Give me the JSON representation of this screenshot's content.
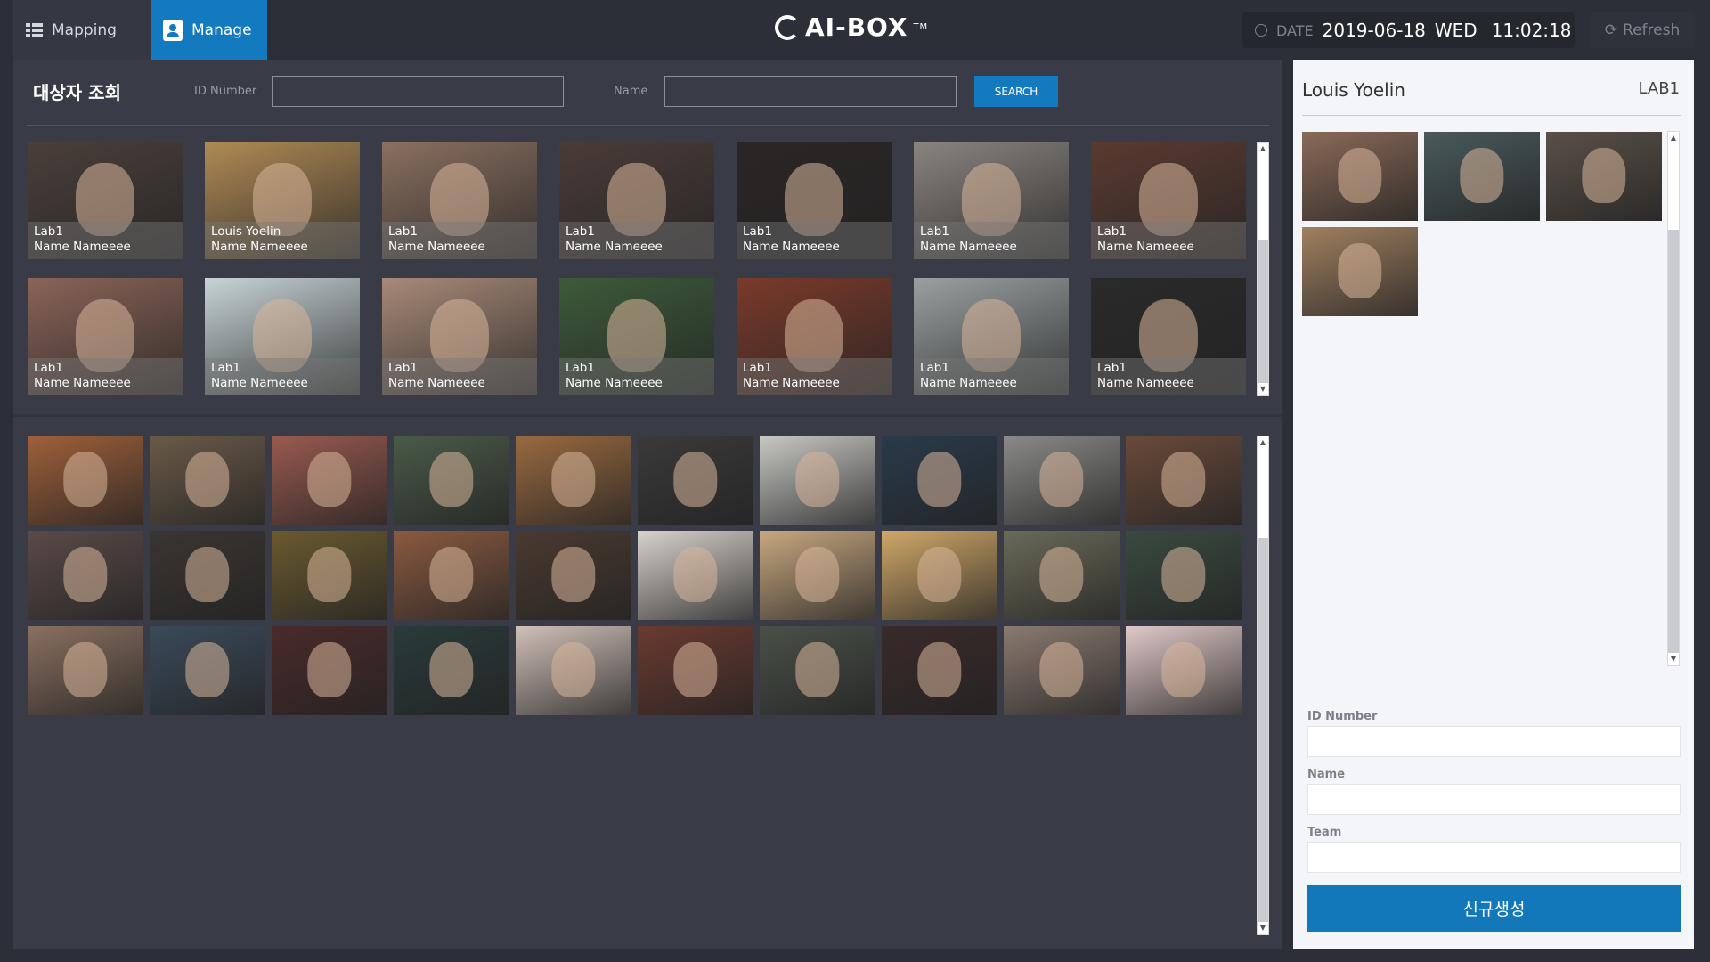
{
  "header": {
    "tabs": [
      {
        "label": "Mapping",
        "icon": "list-icon"
      },
      {
        "label": "Manage",
        "icon": "user-badge-icon",
        "active": true
      }
    ],
    "logo": "AI-BOX",
    "logo_tm": "TM",
    "date_label": "DATE",
    "date": "2019-06-18",
    "weekday": "WED",
    "time": "11:02:18",
    "refresh_label": "Refresh"
  },
  "search": {
    "title": "대상자 조회",
    "id_label": "ID Number",
    "id_value": "",
    "name_label": "Name",
    "name_value": "",
    "button": "SEARCH"
  },
  "cards": [
    {
      "team": "Lab1",
      "name": "Name Nameeee",
      "color": "#4a3f3a"
    },
    {
      "team": "Louis Yoelin",
      "name": "Name Nameeee",
      "color": "#b08a55"
    },
    {
      "team": "Lab1",
      "name": "Name Nameeee",
      "color": "#8a7060"
    },
    {
      "team": "Lab1",
      "name": "Name Nameeee",
      "color": "#4a3c38"
    },
    {
      "team": "Lab1",
      "name": "Name Nameeee",
      "color": "#2a2625"
    },
    {
      "team": "Lab1",
      "name": "Name Nameeee",
      "color": "#8a8480"
    },
    {
      "team": "Lab1",
      "name": "Name Nameeee",
      "color": "#5a3a30"
    },
    {
      "team": "Lab1",
      "name": "Name Nameeee",
      "color": "#8a6458"
    },
    {
      "team": "Lab1",
      "name": "Name Nameeee",
      "color": "#c8d4d6"
    },
    {
      "team": "Lab1",
      "name": "Name Nameeee",
      "color": "#a88a78"
    },
    {
      "team": "Lab1",
      "name": "Name Nameeee",
      "color": "#3d5a3a"
    },
    {
      "team": "Lab1",
      "name": "Name Nameeee",
      "color": "#7a3a2a"
    },
    {
      "team": "Lab1",
      "name": "Name Nameeee",
      "color": "#9aa0a0"
    },
    {
      "team": "Lab1",
      "name": "Name Nameeee",
      "color": "#2a2a2a"
    }
  ],
  "gallery_colors": [
    "#a0603a",
    "#6a5a48",
    "#9a5a50",
    "#4a5a48",
    "#9a6a40",
    "#3a3a3a",
    "#c8c8c4",
    "#2a3a4a",
    "#8a8a88",
    "#6a4a3a",
    "#5a4a48",
    "#3a3532",
    "#6a5a30",
    "#8a5a40",
    "#4a3a30",
    "#d8d2cc",
    "#c8a880",
    "#d0a868",
    "#6a6a58",
    "#3a4a40",
    "#8a7060",
    "#3a4a5a",
    "#4a2a2a",
    "#2a3a3a",
    "#d0c0b8",
    "#6a3a30",
    "#4a5048",
    "#3a2a2a",
    "#8a7a70",
    "#e0c8c8"
  ],
  "detail": {
    "name": "Louis Yoelin",
    "team": "LAB1",
    "photo_colors": [
      "#8a6a58",
      "#4a5a5c",
      "#5a5048",
      "#a08060"
    ],
    "id_label": "ID Number",
    "id_value": "",
    "name_label": "Name",
    "name_value": "",
    "team_label": "Team",
    "team_value": "",
    "create_button": "신규생성"
  },
  "colors": {
    "accent": "#147ac0",
    "bg": "#2c2f38",
    "panel": "#393c47",
    "detail_bg": "#f4f5f9"
  }
}
